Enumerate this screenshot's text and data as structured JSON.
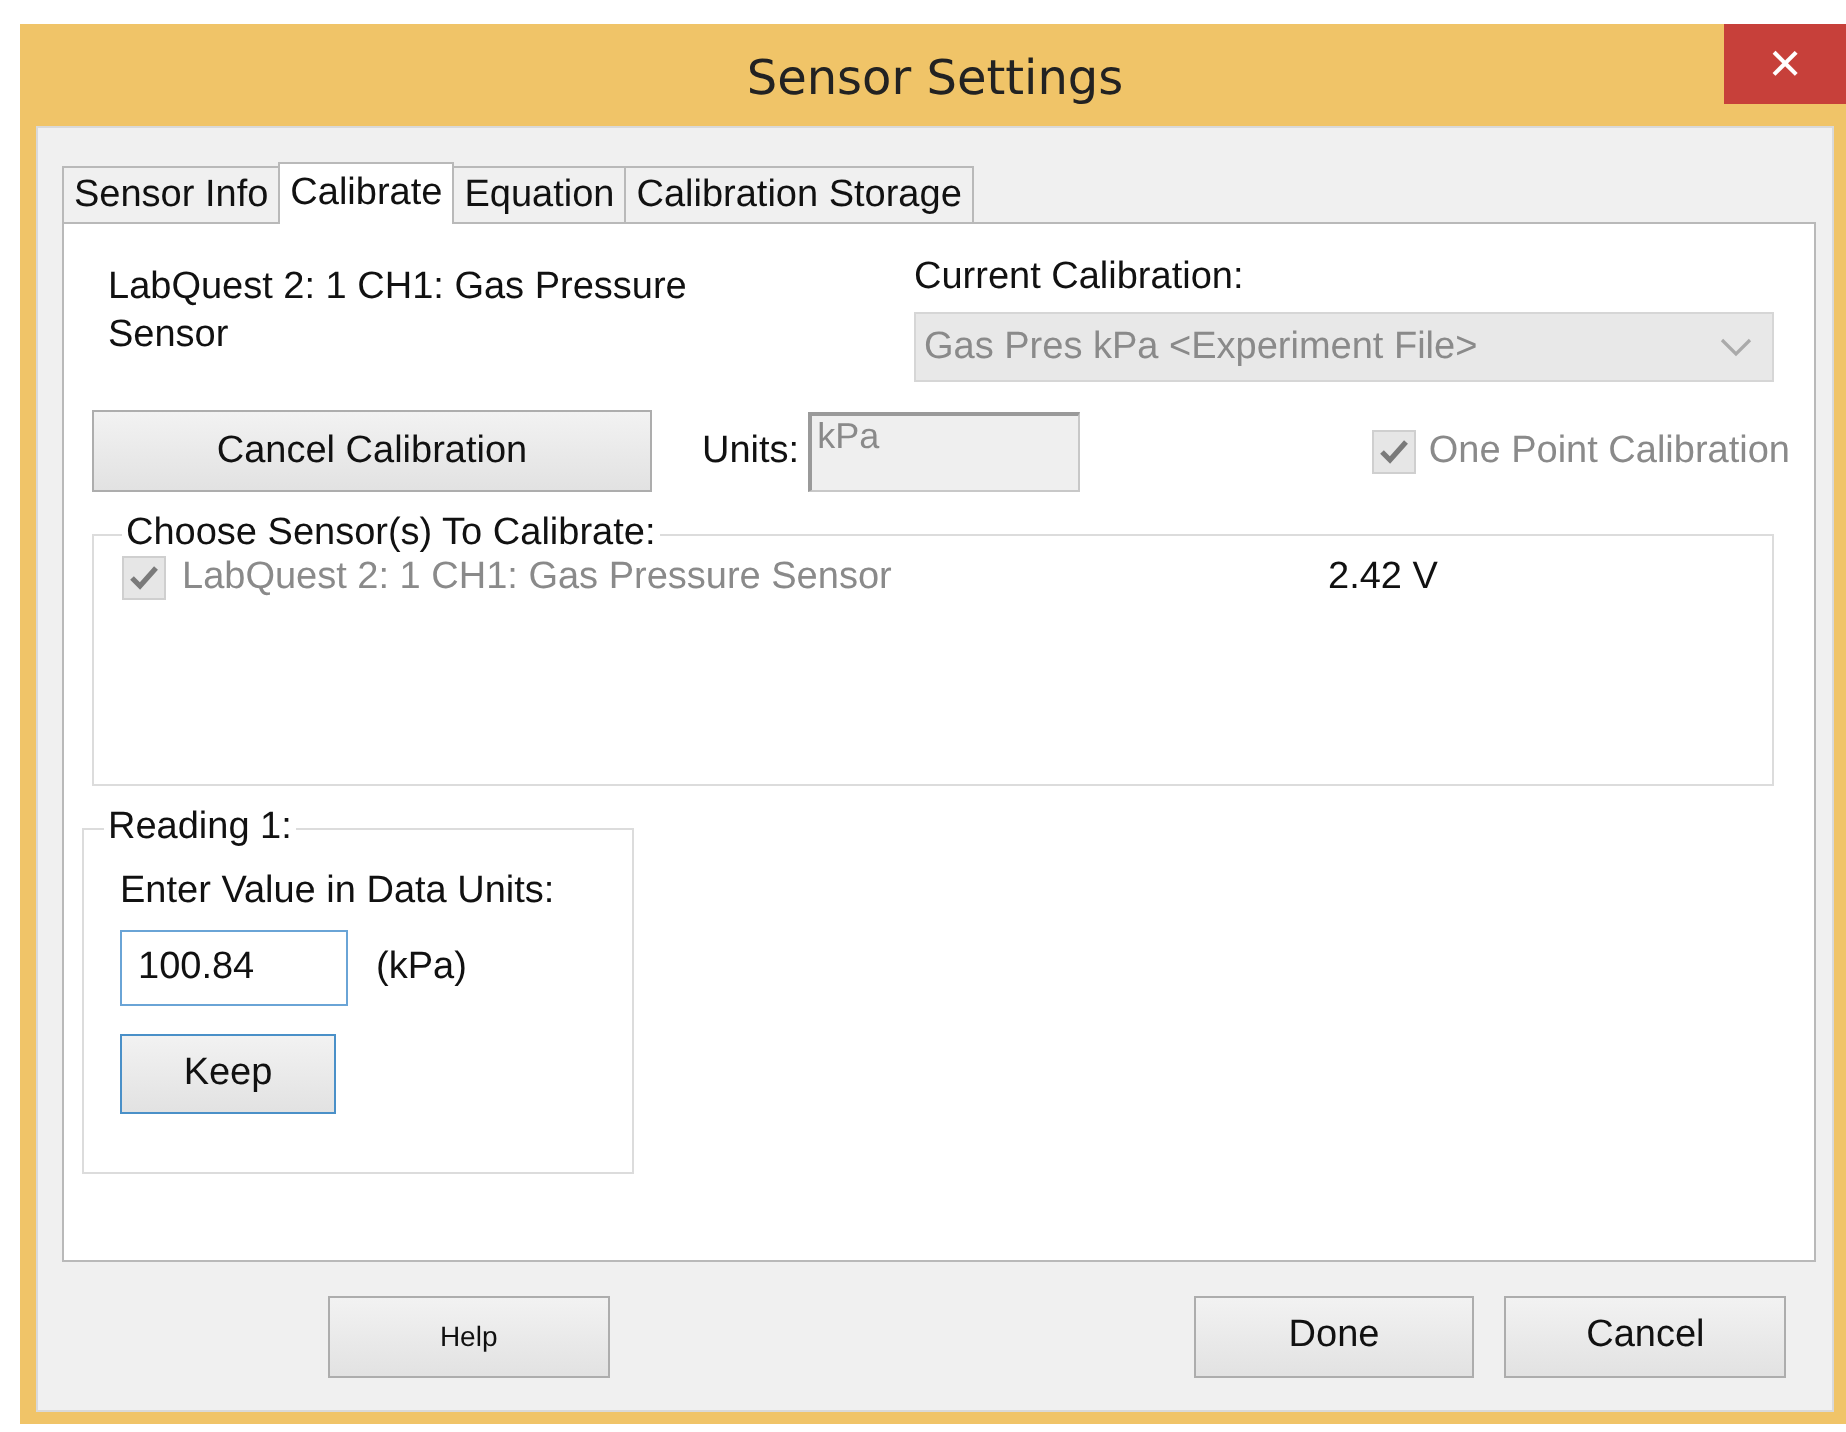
{
  "window": {
    "title": "Sensor Settings",
    "close": "×"
  },
  "tabs": [
    {
      "label": "Sensor Info",
      "selected": false
    },
    {
      "label": "Calibrate",
      "selected": true
    },
    {
      "label": "Equation",
      "selected": false
    },
    {
      "label": "Calibration Storage",
      "selected": false
    }
  ],
  "device_name": "LabQuest 2: 1 CH1: Gas Pressure Sensor",
  "current_calibration": {
    "label": "Current Calibration:",
    "value": "Gas Pres kPa <Experiment File>",
    "disabled": true
  },
  "cancel_calibration_button": "Cancel Calibration",
  "units": {
    "label": "Units:",
    "value": "kPa",
    "disabled": true
  },
  "one_point_calibration": {
    "label": "One Point Calibration",
    "checked": true,
    "disabled": true
  },
  "sensors_group": {
    "legend": "Choose Sensor(s) To Calibrate:",
    "sensors": [
      {
        "label": "LabQuest 2: 1 CH1: Gas Pressure Sensor",
        "checked": true,
        "disabled": true,
        "reading": "2.42 V"
      }
    ]
  },
  "reading_group": {
    "legend": "Reading 1:",
    "prompt": "Enter Value in Data Units:",
    "value": "100.84",
    "unit": "(kPa)",
    "keep_button": "Keep"
  },
  "buttons": [
    {
      "label": "Help",
      "kind": "compact"
    },
    {
      "label": "Done",
      "kind": "standard"
    },
    {
      "label": "Cancel",
      "kind": "standard"
    }
  ]
}
